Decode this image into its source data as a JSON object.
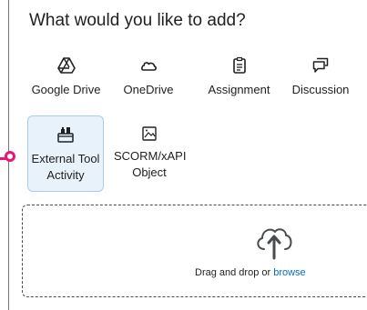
{
  "dialog": {
    "title": "What would you like to add?"
  },
  "options": [
    {
      "label": "Google Drive",
      "icon": "google-drive-icon"
    },
    {
      "label": "OneDrive",
      "icon": "onedrive-icon"
    },
    {
      "label": "Assignment",
      "icon": "assignment-icon"
    },
    {
      "label": "Discussion",
      "icon": "discussion-icon"
    },
    {
      "label": "External Tool Activity",
      "icon": "external-tool-icon",
      "selected": true
    },
    {
      "label": "SCORM/xAPI Object",
      "icon": "scorm-icon"
    }
  ],
  "dropzone": {
    "prefix": "Drag and drop or ",
    "link": "browse",
    "icon": "upload-cloud-icon"
  },
  "colors": {
    "accent": "#006fbf",
    "selected_bg": "#e8f2fb",
    "selected_border": "#a6cdef",
    "connector": "#e6177a"
  }
}
